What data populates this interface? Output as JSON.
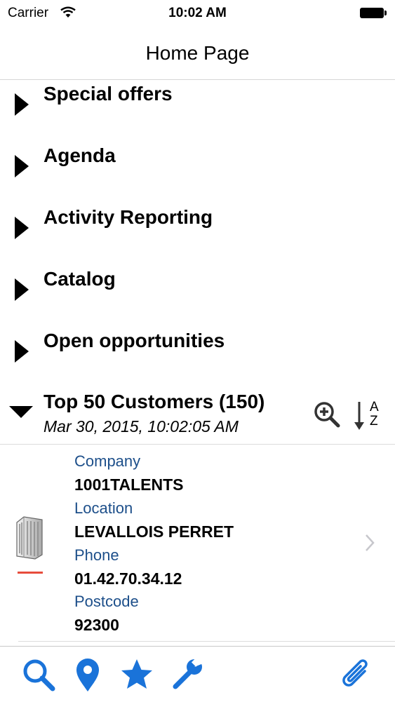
{
  "status_bar": {
    "carrier": "Carrier",
    "time": "10:02 AM",
    "wifi_icon": "wifi-icon",
    "battery_icon": "battery-full-icon"
  },
  "nav": {
    "title": "Home Page"
  },
  "sections": [
    {
      "label": "Special offers",
      "state": "collapsed"
    },
    {
      "label": "Agenda",
      "state": "collapsed"
    },
    {
      "label": "Activity Reporting",
      "state": "collapsed"
    },
    {
      "label": "Catalog",
      "state": "collapsed"
    },
    {
      "label": "Open opportunities",
      "state": "collapsed"
    }
  ],
  "customers": {
    "title": "Top 50 Customers (150)",
    "date": "Mar 30, 2015, 10:02:05 AM",
    "state": "expanded",
    "zoom_icon": "zoom-in-icon",
    "sort_icon": "sort-az-icon",
    "sort_letters": {
      "a": "A",
      "z": "Z"
    },
    "record": {
      "icon": "building-icon",
      "company_label": "Company",
      "company": "1001TALENTS",
      "location_label": "Location",
      "location": "LEVALLOIS PERRET",
      "phone_label": "Phone",
      "phone": "01.42.70.34.12",
      "postcode_label": "Postcode",
      "postcode": "92300"
    }
  },
  "toolbar": {
    "items": [
      "search-icon",
      "location-pin-icon",
      "star-icon",
      "wrench-icon",
      "paperclip-icon"
    ],
    "accent_color": "#1a73d9"
  },
  "colors": {
    "label_blue": "#1d4f8a",
    "separator": "#dcdcdc",
    "indicator_red": "#e74c3c"
  }
}
